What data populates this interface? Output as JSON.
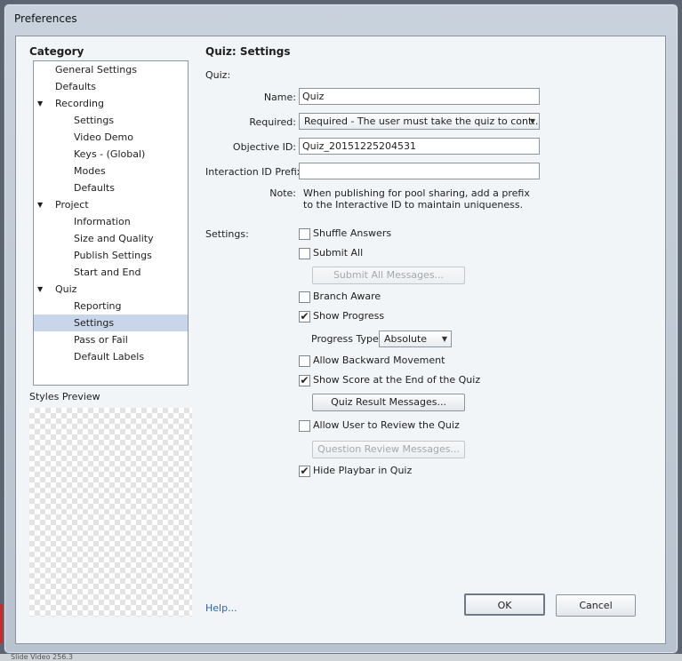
{
  "window": {
    "title": "Preferences"
  },
  "category": {
    "heading": "Category",
    "items": [
      {
        "label": "General Settings",
        "level": 1,
        "expander": ""
      },
      {
        "label": "Defaults",
        "level": 1,
        "expander": ""
      },
      {
        "label": "Recording",
        "level": 1,
        "expander": "▼"
      },
      {
        "label": "Settings",
        "level": 2,
        "expander": ""
      },
      {
        "label": "Video Demo",
        "level": 2,
        "expander": ""
      },
      {
        "label": "Keys - (Global)",
        "level": 2,
        "expander": ""
      },
      {
        "label": "Modes",
        "level": 2,
        "expander": ""
      },
      {
        "label": "Defaults",
        "level": 2,
        "expander": ""
      },
      {
        "label": "Project",
        "level": 1,
        "expander": "▼"
      },
      {
        "label": "Information",
        "level": 2,
        "expander": ""
      },
      {
        "label": "Size and Quality",
        "level": 2,
        "expander": ""
      },
      {
        "label": "Publish Settings",
        "level": 2,
        "expander": ""
      },
      {
        "label": "Start and End",
        "level": 2,
        "expander": ""
      },
      {
        "label": "Quiz",
        "level": 1,
        "expander": "▼"
      },
      {
        "label": "Reporting",
        "level": 2,
        "expander": ""
      },
      {
        "label": "Settings",
        "level": 2,
        "expander": "",
        "selected": true
      },
      {
        "label": "Pass or Fail",
        "level": 2,
        "expander": ""
      },
      {
        "label": "Default Labels",
        "level": 2,
        "expander": ""
      }
    ],
    "styles_preview_label": "Styles Preview"
  },
  "panel": {
    "title": "Quiz: Settings",
    "quiz_section": "Quiz:",
    "name_label": "Name:",
    "name_value": "Quiz",
    "required_label": "Required:",
    "required_value": "Required - The user must take the quiz to cont...",
    "objective_label": "Objective ID:",
    "objective_value": "Quiz_20151225204531",
    "prefix_label": "Interaction ID Prefix:",
    "prefix_value": "",
    "note_label": "Note:",
    "note_line1": "When publishing for pool sharing, add a prefix",
    "note_line2": "to the Interactive ID to maintain uniqueness.",
    "settings_label": "Settings:",
    "options": {
      "shuffle_answers": {
        "label": "Shuffle Answers",
        "checked": false
      },
      "submit_all": {
        "label": "Submit All",
        "checked": false
      },
      "submit_all_messages": "Submit All Messages...",
      "branch_aware": {
        "label": "Branch Aware",
        "checked": false
      },
      "show_progress": {
        "label": "Show Progress",
        "checked": true
      },
      "progress_type_label": "Progress Type:",
      "progress_type_value": "Absolute",
      "allow_backward": {
        "label": "Allow Backward Movement",
        "checked": false
      },
      "show_score": {
        "label": "Show Score at the End of the Quiz",
        "checked": true
      },
      "quiz_result_messages": "Quiz Result Messages...",
      "allow_review": {
        "label": "Allow User to Review the Quiz",
        "checked": false
      },
      "question_review_messages": "Question Review Messages...",
      "hide_playbar": {
        "label": "Hide Playbar in Quiz",
        "checked": true
      }
    }
  },
  "footer": {
    "help": "Help...",
    "ok": "OK",
    "cancel": "Cancel"
  },
  "status_strip": "Slide Video 256.3",
  "icons": {
    "checkmark": "✔",
    "dropdown": "▼",
    "tree_expander": "▼"
  }
}
